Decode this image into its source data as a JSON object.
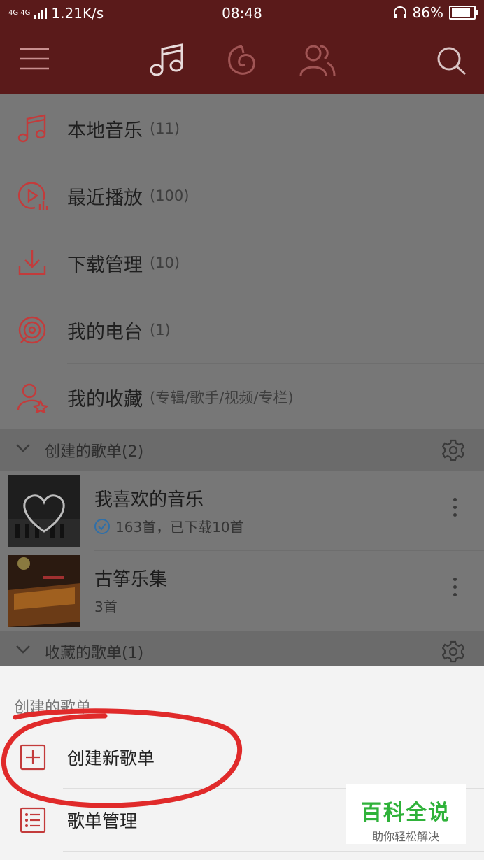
{
  "status": {
    "network": "4G 4G",
    "speed": "1.21K/s",
    "time": "08:48",
    "battery": "86%",
    "battery_level": 0.86
  },
  "nav": {
    "icons": [
      "menu-icon",
      "music-note-icon",
      "netease-radio-icon",
      "friends-icon",
      "search-icon"
    ]
  },
  "menu": [
    {
      "label": "本地音乐",
      "count": "(11)",
      "icon": "music-note-icon"
    },
    {
      "label": "最近播放",
      "count": "(100)",
      "icon": "recent-play-icon"
    },
    {
      "label": "下载管理",
      "count": "(10)",
      "icon": "download-icon"
    },
    {
      "label": "我的电台",
      "count": "(1)",
      "icon": "radio-icon"
    },
    {
      "label": "我的收藏",
      "count": "(专辑/歌手/视频/专栏)",
      "icon": "favorites-icon"
    }
  ],
  "created_section": {
    "label": "创建的歌单(2)"
  },
  "playlists": [
    {
      "name": "我喜欢的音乐",
      "sub": "163首，已下载10首"
    },
    {
      "name": "古筝乐集",
      "sub": "3首"
    }
  ],
  "collected_section": {
    "label": "收藏的歌单(1)"
  },
  "sheet": {
    "title": "创建的歌单",
    "items": [
      {
        "label": "创建新歌单"
      },
      {
        "label": "歌单管理"
      }
    ]
  },
  "watermark": {
    "title": "百科全说",
    "subtitle": "助你轻松解决"
  },
  "colors": {
    "brand_red": "#c33b3b",
    "header_bg": "#5a1a1a",
    "watermark_green": "#2fb23a"
  }
}
